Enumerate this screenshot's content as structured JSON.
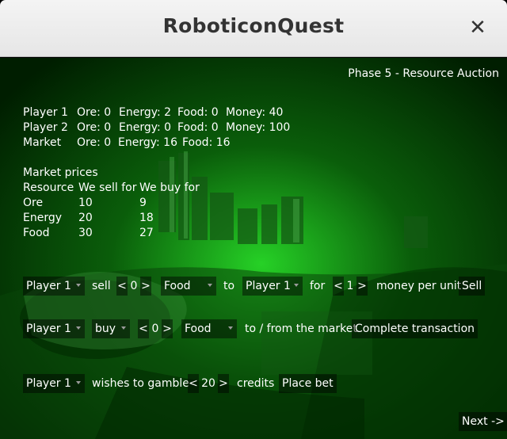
{
  "window": {
    "title": "RoboticonQuest",
    "close_glyph": "✕"
  },
  "phase": "Phase 5 - Resource Auction",
  "status": [
    {
      "name": "Player 1",
      "ore": "Ore: 0",
      "energy": "Energy: 2",
      "food": "Food: 0",
      "money": "Money: 40"
    },
    {
      "name": "Player 2",
      "ore": "Ore: 0",
      "energy": "Energy: 0",
      "food": "Food: 0",
      "money": "Money: 100"
    },
    {
      "name": "Market",
      "ore": "Ore: 0",
      "energy": "Energy: 16",
      "food": "Food: 16",
      "money": ""
    }
  ],
  "prices": {
    "heading": "Market prices",
    "columns": [
      "Resource",
      "We sell for",
      "We buy for"
    ],
    "rows": [
      [
        "Ore",
        "10",
        "9"
      ],
      [
        "Energy",
        "20",
        "18"
      ],
      [
        "Food",
        "30",
        "27"
      ]
    ]
  },
  "trade": {
    "seller": "Player 1",
    "sell_label": "sell",
    "qty_dec": "<",
    "qty": "0",
    "qty_inc": ">",
    "resource": "Food",
    "to_label": "to",
    "buyer": "Player 1",
    "for_label": "for",
    "price_dec": "<",
    "price": "1",
    "price_inc": ">",
    "unit_label": "money per unit",
    "sell_button": "Sell"
  },
  "market": {
    "player": "Player 1",
    "action": "buy",
    "qty_dec": "<",
    "qty": "0",
    "qty_inc": ">",
    "resource": "Food",
    "label": "to / from the market",
    "button": "Complete transaction"
  },
  "gamble": {
    "player": "Player 1",
    "label": "wishes to gamble",
    "dec": "<",
    "amount": "20",
    "inc": ">",
    "credits_label": "credits",
    "button": "Place bet"
  },
  "next_button": "Next ->"
}
